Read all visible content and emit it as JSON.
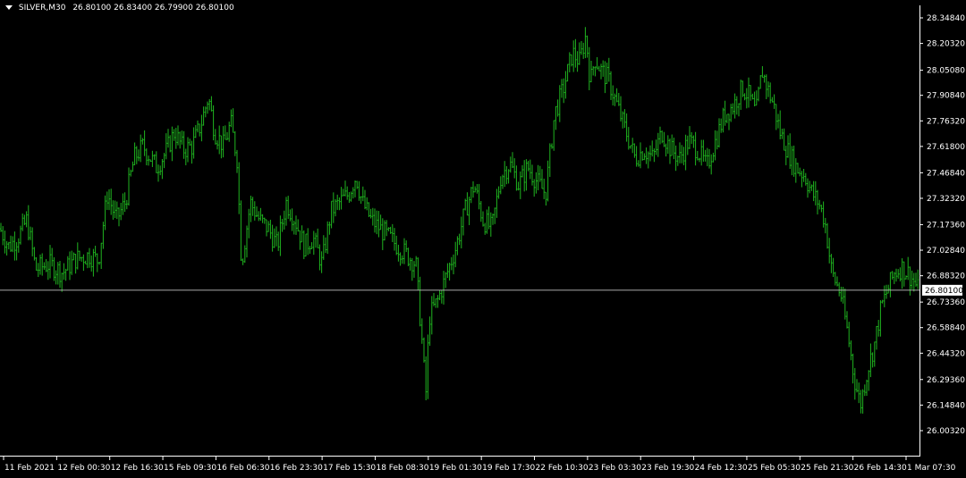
{
  "header": {
    "symbol": "SILVER,M30",
    "ohlc": "26.80100 26.83400 26.79900 26.80100"
  },
  "colors": {
    "bars": "#1fb51f",
    "background": "#000000",
    "axis": "#ffffff",
    "price_line": "#c0c0c0"
  },
  "current_price": {
    "value": 26.801,
    "label": "26.80100"
  },
  "chart_data": {
    "type": "line",
    "title": "SILVER,M30",
    "style": "ohlc-bars",
    "grid": false,
    "ylim": [
      26.0032,
      28.3484
    ],
    "y_ticks": [
      "28.34840",
      "28.20320",
      "28.05080",
      "27.90840",
      "27.76320",
      "27.61800",
      "27.46840",
      "27.32320",
      "27.17360",
      "27.02840",
      "26.88320",
      "26.73360",
      "26.58840",
      "26.44320",
      "26.29360",
      "26.14840",
      "26.00320"
    ],
    "x_ticks": [
      "11 Feb 2021",
      "12 Feb 00:30",
      "12 Feb 16:30",
      "15 Feb 09:30",
      "16 Feb 06:30",
      "16 Feb 23:30",
      "17 Feb 15:30",
      "18 Feb 08:30",
      "19 Feb 01:30",
      "19 Feb 17:30",
      "22 Feb 10:30",
      "23 Feb 03:30",
      "23 Feb 19:30",
      "24 Feb 12:30",
      "25 Feb 05:30",
      "25 Feb 21:30",
      "26 Feb 14:30",
      "1 Mar 07:30"
    ],
    "series": [
      {
        "points": [
          [
            0,
            27.15
          ],
          [
            10,
            27.05
          ],
          [
            20,
            27.1
          ],
          [
            30,
            27.2
          ],
          [
            40,
            26.92
          ],
          [
            55,
            26.95
          ],
          [
            70,
            26.9
          ],
          [
            85,
            26.98
          ],
          [
            100,
            27.0
          ],
          [
            110,
            26.97
          ],
          [
            120,
            27.35
          ],
          [
            130,
            27.2
          ],
          [
            140,
            27.3
          ],
          [
            150,
            27.55
          ],
          [
            160,
            27.62
          ],
          [
            175,
            27.5
          ],
          [
            185,
            27.58
          ],
          [
            195,
            27.7
          ],
          [
            205,
            27.6
          ],
          [
            215,
            27.62
          ],
          [
            225,
            27.75
          ],
          [
            233,
            27.9
          ],
          [
            240,
            27.7
          ],
          [
            250,
            27.62
          ],
          [
            258,
            27.75
          ],
          [
            265,
            27.55
          ],
          [
            270,
            26.95
          ],
          [
            280,
            27.3
          ],
          [
            290,
            27.2
          ],
          [
            300,
            27.15
          ],
          [
            310,
            27.05
          ],
          [
            320,
            27.3
          ],
          [
            330,
            27.2
          ],
          [
            340,
            27.05
          ],
          [
            350,
            27.1
          ],
          [
            360,
            26.95
          ],
          [
            370,
            27.25
          ],
          [
            380,
            27.3
          ],
          [
            390,
            27.35
          ],
          [
            398,
            27.45
          ],
          [
            405,
            27.3
          ],
          [
            415,
            27.2
          ],
          [
            425,
            27.15
          ],
          [
            435,
            27.1
          ],
          [
            445,
            27.05
          ],
          [
            455,
            27.0
          ],
          [
            465,
            26.95
          ],
          [
            472,
            26.5
          ],
          [
            476,
            26.2
          ],
          [
            480,
            26.65
          ],
          [
            490,
            26.75
          ],
          [
            500,
            26.9
          ],
          [
            510,
            27.05
          ],
          [
            520,
            27.25
          ],
          [
            530,
            27.4
          ],
          [
            540,
            27.2
          ],
          [
            550,
            27.15
          ],
          [
            560,
            27.45
          ],
          [
            570,
            27.52
          ],
          [
            580,
            27.4
          ],
          [
            590,
            27.5
          ],
          [
            600,
            27.42
          ],
          [
            610,
            27.35
          ],
          [
            620,
            27.8
          ],
          [
            630,
            27.95
          ],
          [
            640,
            28.15
          ],
          [
            648,
            28.1
          ],
          [
            655,
            28.25
          ],
          [
            660,
            27.98
          ],
          [
            665,
            28.12
          ],
          [
            672,
            28.05
          ],
          [
            680,
            28.0
          ],
          [
            690,
            27.85
          ],
          [
            700,
            27.7
          ],
          [
            710,
            27.55
          ],
          [
            720,
            27.6
          ],
          [
            730,
            27.55
          ],
          [
            740,
            27.7
          ],
          [
            750,
            27.6
          ],
          [
            760,
            27.55
          ],
          [
            770,
            27.65
          ],
          [
            780,
            27.6
          ],
          [
            790,
            27.5
          ],
          [
            800,
            27.65
          ],
          [
            810,
            27.8
          ],
          [
            820,
            27.85
          ],
          [
            830,
            27.95
          ],
          [
            838,
            27.9
          ],
          [
            845,
            27.8
          ],
          [
            852,
            28.05
          ],
          [
            858,
            27.95
          ],
          [
            865,
            27.85
          ],
          [
            872,
            27.7
          ],
          [
            880,
            27.6
          ],
          [
            890,
            27.5
          ],
          [
            900,
            27.45
          ],
          [
            908,
            27.35
          ],
          [
            915,
            27.3
          ],
          [
            922,
            27.2
          ],
          [
            930,
            26.9
          ],
          [
            940,
            26.78
          ],
          [
            948,
            26.55
          ],
          [
            955,
            26.3
          ],
          [
            962,
            26.15
          ],
          [
            970,
            26.35
          ],
          [
            978,
            26.5
          ],
          [
            985,
            26.7
          ],
          [
            992,
            26.8
          ],
          [
            1000,
            26.9
          ],
          [
            1008,
            26.93
          ],
          [
            1015,
            26.9
          ],
          [
            1022,
            26.85
          ],
          [
            1027,
            26.8
          ]
        ]
      }
    ]
  }
}
